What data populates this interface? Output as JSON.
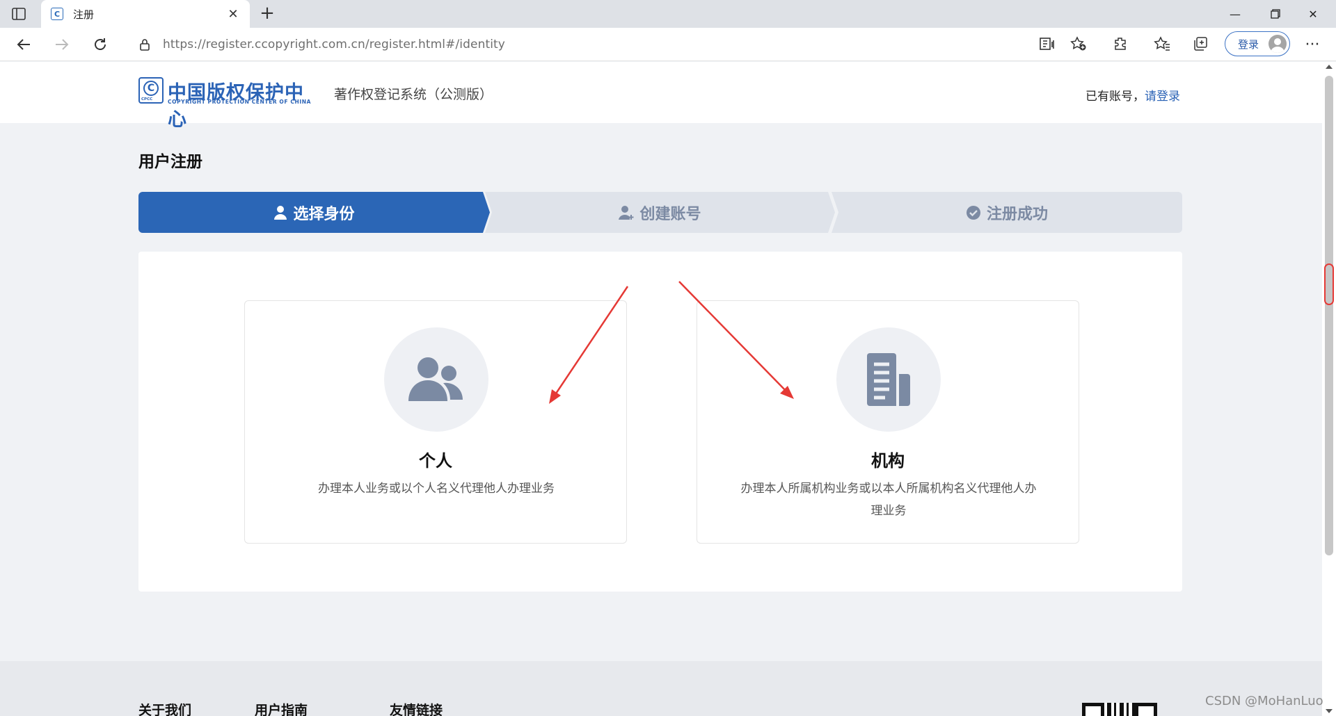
{
  "browser": {
    "tab_title": "注册",
    "favicon_letter": "C",
    "url_host": "https://register.ccopyright.com.cn",
    "url_path": "/register.html#/identity",
    "profile_login_label": "登录"
  },
  "header": {
    "logo_cn": "中国版权保护中心",
    "logo_en": "COPYRIGHT PROTECTION CENTER OF CHINA",
    "logo_abbrev": "CPCC",
    "system_name": "著作权登记系统（公测版）",
    "has_account_text": "已有账号，",
    "login_link": "请登录"
  },
  "page": {
    "title": "用户注册"
  },
  "steps": [
    {
      "label": "选择身份",
      "active": true,
      "icon": "user-icon"
    },
    {
      "label": "创建账号",
      "active": false,
      "icon": "user-add-icon"
    },
    {
      "label": "注册成功",
      "active": false,
      "icon": "check-circle-icon"
    }
  ],
  "cards": [
    {
      "title": "个人",
      "desc": "办理本人业务或以个人名义代理他人办理业务",
      "icon": "people-icon"
    },
    {
      "title": "机构",
      "desc": "办理本人所属机构业务或以本人所属机构名义代理他人办理业务",
      "icon": "building-icon"
    }
  ],
  "footer": {
    "links": [
      "关于我们",
      "用户指南",
      "友情链接"
    ]
  },
  "watermark": "CSDN @MoHanLuo",
  "colors": {
    "primary": "#2b66b6",
    "step_inactive_bg": "#dfe3ea",
    "step_inactive_text": "#7c8aa3",
    "annotation_arrow": "#e53935",
    "icon_gray": "#7b8aa3"
  }
}
